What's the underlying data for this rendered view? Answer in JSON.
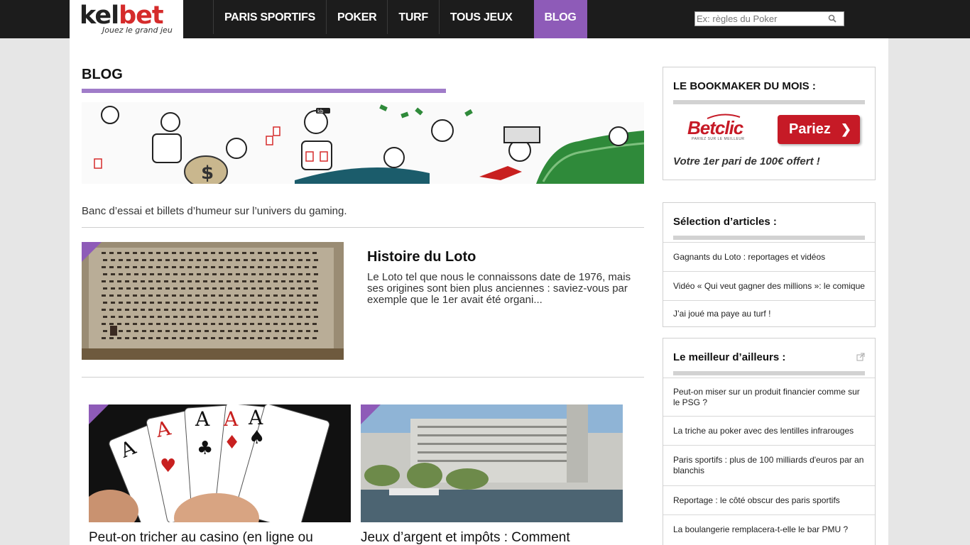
{
  "header": {
    "logo_main_k": "kel",
    "logo_main_b": "bet",
    "logo_tagline": "Jouez le grand jeu",
    "nav": [
      "PARIS SPORTIFS",
      "POKER",
      "TURF",
      "TOUS JEUX",
      "BLOG"
    ],
    "active_nav": "BLOG",
    "search_placeholder": "Ex: règles du Poker"
  },
  "main": {
    "title": "BLOG",
    "intro": "Banc d’essai et billets d’humeur sur l’univers du gaming.",
    "featured": {
      "title": "Histoire du Loto",
      "excerpt": "Le Loto tel que nous le connaissons date de 1976, mais ses origines sont bien plus anciennes : saviez-vous par exemple que le 1er avait été organi..."
    },
    "cards": [
      {
        "title": "Peut-on tricher au casino (en ligne ou"
      },
      {
        "title": "Jeux d’argent et impôts : Comment"
      }
    ]
  },
  "sidebar": {
    "bookmaker": {
      "heading": "LE BOOKMAKER DU MOIS :",
      "brand": "Betclic",
      "brand_tagline": "PARIEZ SUR LE MEILLEUR",
      "button": "Pariez",
      "offer": "Votre 1er pari de 100€ offert !"
    },
    "selection": {
      "heading": "Sélection d’articles :",
      "items": [
        "Gagnants du Loto : reportages et vidéos",
        "Vidéo « Qui veut gagner des millions »: le comique",
        "J’ai joué ma paye au turf !"
      ]
    },
    "elsewhere": {
      "heading": "Le meilleur d’ailleurs :",
      "items": [
        "Peut-on miser sur un produit financier comme sur le PSG ?",
        "La triche au poker avec des lentilles infrarouges",
        "Paris sportifs : plus de 100 milliards d'euros par an blanchis",
        "Reportage : le côté obscur des paris sportifs",
        "La boulangerie remplacera-t-elle le bar PMU ?"
      ]
    }
  },
  "colors": {
    "accent": "#8e5bb8",
    "topbar": "#1c1c1c",
    "brand_red": "#d52b2b",
    "betclic_red": "#c61a26"
  }
}
